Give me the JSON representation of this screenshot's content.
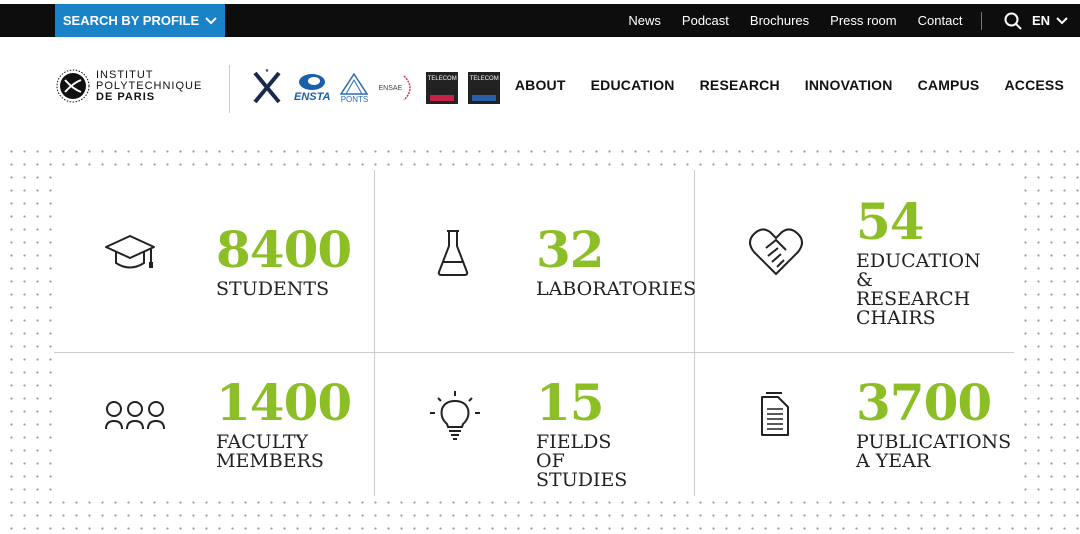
{
  "topbar": {
    "profile_label": "SEARCH BY PROFILE",
    "links": [
      "News",
      "Podcast",
      "Brochures",
      "Press room",
      "Contact"
    ],
    "lang": "EN"
  },
  "logo": {
    "line1": "INSTITUT",
    "line2": "POLYTECHNIQUE",
    "line3": "DE PARIS"
  },
  "partners": {
    "ensta": "ENSTA",
    "ponts": "PONTS",
    "ensae": "ENSAE",
    "telecom_paris": "TELECOM",
    "telecom_sud": "TELECOM"
  },
  "nav": [
    "ABOUT",
    "EDUCATION",
    "RESEARCH",
    "INNOVATION",
    "CAMPUS",
    "ACCESS"
  ],
  "colors": {
    "accent_green": "#8cbf26",
    "profile_blue": "#1a82c7",
    "topbar": "#0d0d0d"
  },
  "stats": [
    {
      "icon": "graduation-cap-icon",
      "value": "8400",
      "label": "STUDENTS"
    },
    {
      "icon": "flask-icon",
      "value": "32",
      "label": "LABORATORIES"
    },
    {
      "icon": "handshake-icon",
      "value": "54",
      "label": "EDUCATION & RESEARCH CHAIRS"
    },
    {
      "icon": "people-icon",
      "value": "1400",
      "label": "FACULTY MEMBERS"
    },
    {
      "icon": "lightbulb-icon",
      "value": "15",
      "label": "FIELDS OF STUDIES"
    },
    {
      "icon": "document-icon",
      "value": "3700",
      "label": "PUBLICATIONS A YEAR"
    }
  ]
}
